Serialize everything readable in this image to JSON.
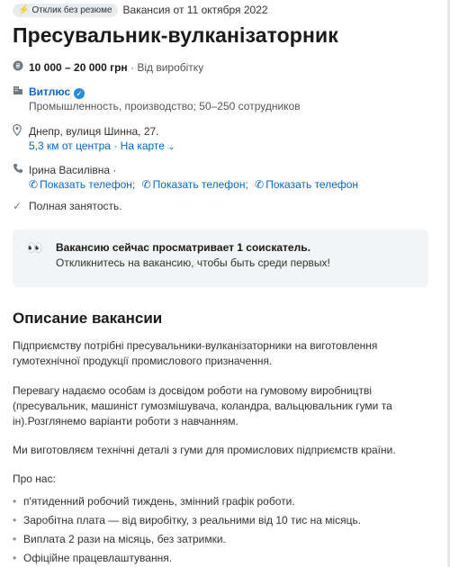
{
  "header": {
    "badge_label": "Отклик без резюме",
    "posted_date": "Вакансия от 11 октября 2022",
    "title": "Пресувальник-вулканізаторник"
  },
  "salary": {
    "amount": "10 000 – 20 000 грн",
    "note": " · Від виробітку"
  },
  "company": {
    "name": "Витлюс",
    "details": "Промышленность, производство; 50–250 сотрудников"
  },
  "location": {
    "address": "Днепр, вулиця Шинна, 27.",
    "distance": "5,3 км от центра",
    "separator": " · ",
    "map_link": "На карте"
  },
  "contact": {
    "name": "Ірина Василівна ·",
    "phone_links": [
      "Показать телефон;",
      "Показать телефон;",
      "Показать телефон"
    ]
  },
  "employment": "Полная занятость.",
  "alert": {
    "title": "Вакансию сейчас просматривает 1 соискатель.",
    "subtitle": "Откликнитесь на вакансию, чтобы быть среди первых!"
  },
  "description": {
    "heading": "Описание вакансии",
    "paragraphs": [
      "Підприємству потрібні пресувальники-вулканізаторники на виготовлення гумотехнічної продукції промислового призначення.",
      "Перевагу надаємо особам із досвідом роботи на гумовому виробництві (пресувальник, машиніст гумозмішувача, коландра, вальцювальник гуми та ін).Розглянемо варіанти роботи з навчанням.",
      "Ми виготовляєм технічні деталі з гуми для промислових підприємств країни.",
      "Про нас:"
    ],
    "bullets": [
      "п'ятиденний робочий тиждень, змінний графік роботи.",
      "Заробітна плата — від виробітку, з реальними від 10 тис на місяць.",
      "Виплата 2 рази на місяць, без затримки.",
      "Офіційне працевлаштування."
    ]
  },
  "icons": {
    "salary": "currency-icon",
    "company": "building-icon",
    "location": "map-pin-icon",
    "contact": "phone-icon",
    "employment": "check-icon",
    "alert": "eyes-icon"
  },
  "colors": {
    "link": "#0a66c2",
    "badge_bg": "#e9ecee",
    "alert_bg": "#f2f4f5",
    "verified": "#2b8bd8"
  }
}
